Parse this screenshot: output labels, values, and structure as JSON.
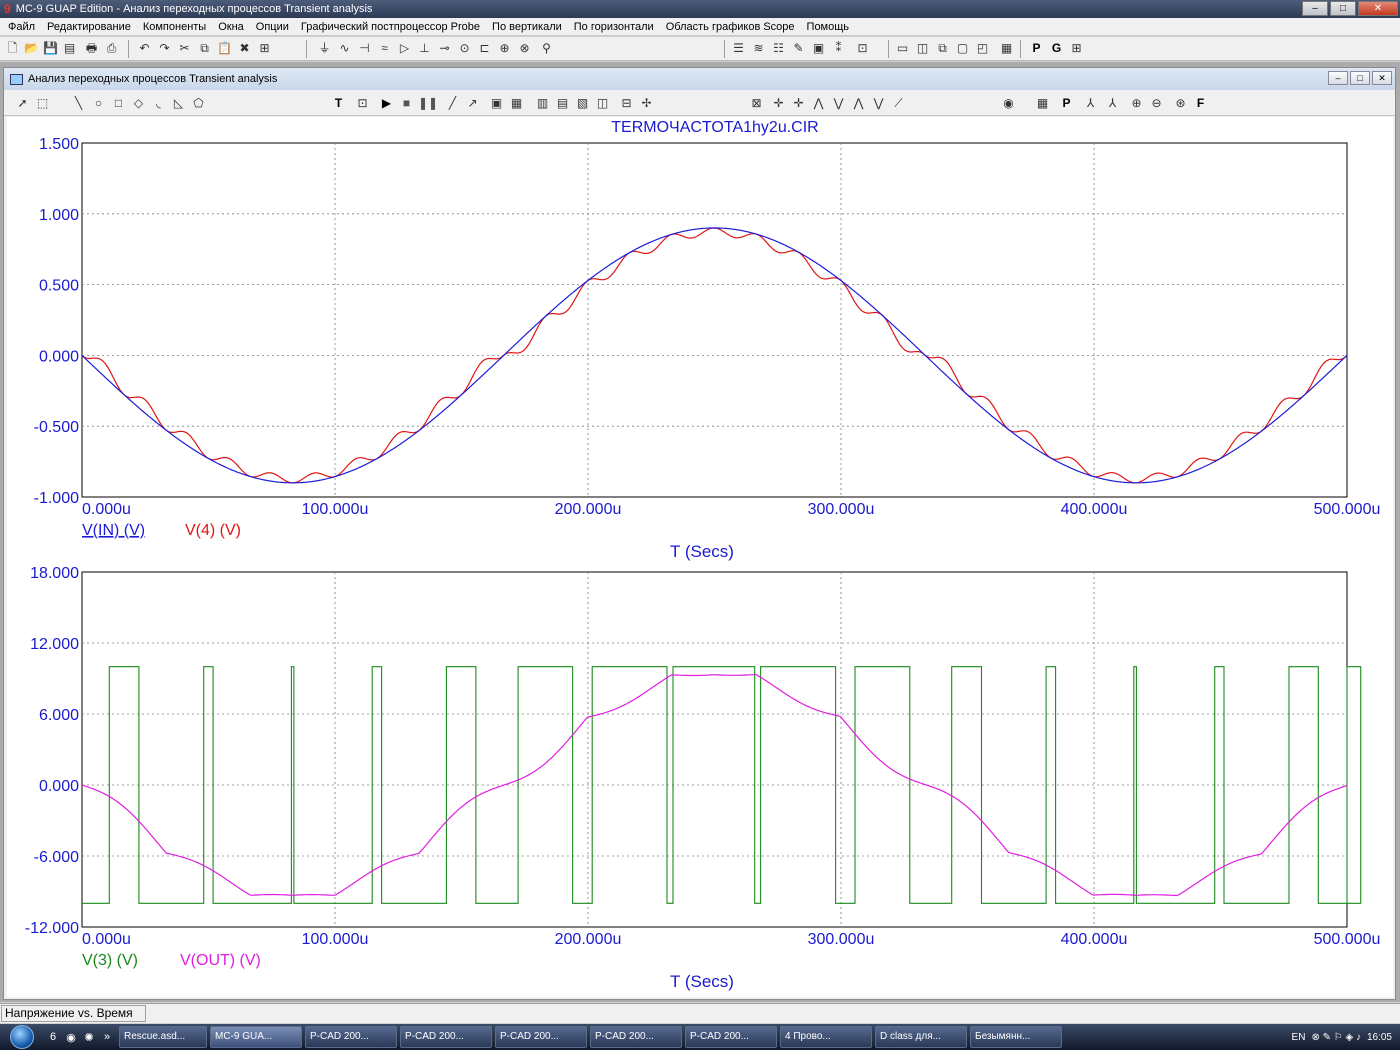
{
  "window": {
    "title": "MC-9 GUAP Edition - Анализ переходных процессов Transient analysis",
    "minimize": "–",
    "maximize": "□",
    "close": "✕"
  },
  "menu": [
    "Файл",
    "Редактирование",
    "Компоненты",
    "Окна",
    "Опции",
    "Графический постпроцессор Probe",
    "По вертикали",
    "По горизонтали",
    "Область графиков Scope",
    "Помощь"
  ],
  "child_window": {
    "title": "Анализ переходных процессов Transient analysis"
  },
  "plot": {
    "title": "TERMOЧACTOTA1hy2u.CIR"
  },
  "status": {
    "text": "Напряжение vs. Время"
  },
  "taskbar": {
    "items": [
      "Rescue.asd...",
      "MC-9 GUA...",
      "P-CAD 200...",
      "P-CAD 200...",
      "P-CAD 200...",
      "P-CAD 200...",
      "P-CAD 200...",
      "4 Прово...",
      "D class для...",
      "Безымянн..."
    ],
    "lang": "EN",
    "clock": "16:05"
  },
  "colors": {
    "axis_labels": "#1a1ad0",
    "grid": "#808080",
    "v_in": "#1c1cd8",
    "v_4": "#e01515",
    "v_3": "#1b8a1b",
    "v_out": "#e01ee0"
  },
  "chart_data": [
    {
      "type": "line",
      "title": "TERMOЧACTOTA1hy2u.CIR",
      "xlabel": "T (Secs)",
      "ylabel": "",
      "xlim": [
        0,
        500
      ],
      "ylim": [
        -1.0,
        1.5
      ],
      "xticks": [
        "0.000u",
        "100.000u",
        "200.000u",
        "300.000u",
        "400.000u",
        "500.000u"
      ],
      "yticks": [
        "1.500",
        "1.000",
        "0.500",
        "0.000",
        "-0.500",
        "-1.000"
      ],
      "grid": true,
      "legend_position": "bottom-left",
      "series": [
        {
          "name": "V(IN) (V)",
          "color": "#1c1cd8",
          "amplitude": 0.9,
          "period_us": 333.3,
          "phase": "negative-sine"
        },
        {
          "name": "V(4) (V)",
          "color": "#e01515",
          "amplitude": 0.9,
          "ripple": 0.1,
          "ripple_period_us": 33.3
        }
      ]
    },
    {
      "type": "line",
      "title": "",
      "xlabel": "T (Secs)",
      "ylabel": "",
      "xlim": [
        0,
        500
      ],
      "ylim": [
        -12,
        18
      ],
      "xticks": [
        "0.000u",
        "100.000u",
        "200.000u",
        "300.000u",
        "400.000u",
        "500.000u"
      ],
      "yticks": [
        "18.000",
        "12.000",
        "6.000",
        "0.000",
        "-6.000",
        "-12.000"
      ],
      "grid": true,
      "legend_position": "bottom-left",
      "series": [
        {
          "name": "V(3) (V)",
          "color": "#1b8a1b",
          "high": 10,
          "low": -10,
          "kind": "PWM square wave",
          "carrier_period_us": 33.3
        },
        {
          "name": "V(OUT) (V)",
          "color": "#e01ee0",
          "amplitude": 9.8,
          "ripple": 1.2
        }
      ]
    }
  ]
}
